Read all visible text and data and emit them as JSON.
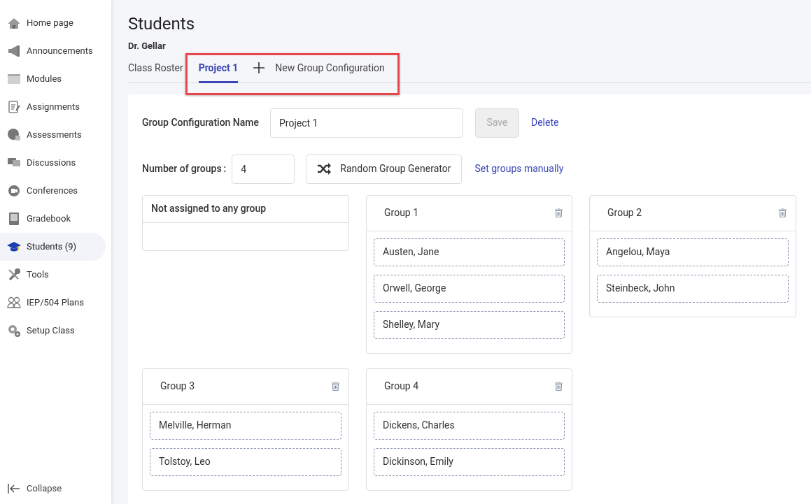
{
  "sidebar": {
    "items": [
      {
        "label": "Home page",
        "selected": false
      },
      {
        "label": "Announcements",
        "selected": false
      },
      {
        "label": "Modules",
        "selected": false
      },
      {
        "label": "Assignments",
        "selected": false
      },
      {
        "label": "Assessments",
        "selected": false
      },
      {
        "label": "Discussions",
        "selected": false
      },
      {
        "label": "Conferences",
        "selected": false
      },
      {
        "label": "Gradebook",
        "selected": false
      },
      {
        "label": "Students (9)",
        "selected": true
      },
      {
        "label": "Tools",
        "selected": false
      },
      {
        "label": "IEP/504 Plans",
        "selected": false
      },
      {
        "label": "Setup Class",
        "selected": false
      }
    ],
    "collapse": "Collapse"
  },
  "page": {
    "title": "Students",
    "subtitle": "Dr. Gellar"
  },
  "tabs": [
    {
      "label": "Class Roster",
      "selected": false
    },
    {
      "label": "Project 1",
      "selected": true
    },
    {
      "label": "New Group Configuration",
      "selected": false,
      "kind": "add"
    }
  ],
  "form": {
    "name_label": "Group Configuration Name",
    "name_value": "Project 1",
    "save": "Save",
    "save_disabled": true,
    "delete": "Delete",
    "count_label": "Number of groups",
    "count_colon": ":",
    "count_value": "4",
    "random": "Random Group Generator",
    "manual": "Set groups manually"
  },
  "unassigned": {
    "title": "Not assigned to any group"
  },
  "groups": [
    {
      "title": "Group 1",
      "members": [
        "Austen, Jane",
        "Orwell, George",
        "Shelley, Mary"
      ]
    },
    {
      "title": "Group 2",
      "members": [
        "Angelou, Maya",
        "Steinbeck, John"
      ]
    },
    {
      "title": "Group 3",
      "members": [
        "Melville, Herman",
        "Tolstoy, Leo"
      ]
    },
    {
      "title": "Group 4",
      "members": [
        "Dickens, Charles",
        "Dickinson, Emily"
      ]
    }
  ]
}
